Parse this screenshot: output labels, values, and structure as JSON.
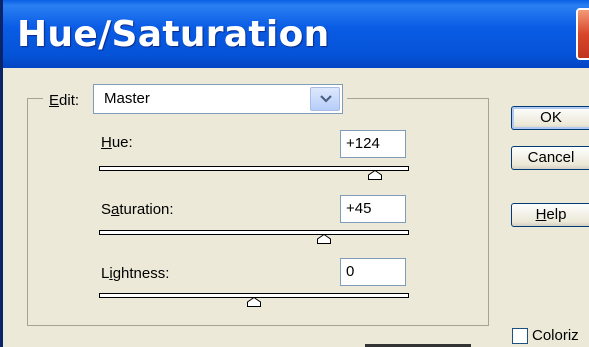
{
  "window": {
    "title": "Hue/Saturation"
  },
  "edit": {
    "label_u": "E",
    "label_rest": "dit:",
    "selected": "Master"
  },
  "sliders": [
    {
      "label_u": "H",
      "label_rest": "ue:",
      "label_pre": "",
      "value": "+124",
      "position": 0.89
    },
    {
      "label_pre": "S",
      "label_u": "a",
      "label_rest": "turation:",
      "value": "+45",
      "position": 0.725
    },
    {
      "label_pre": "L",
      "label_u": "i",
      "label_rest": "ghtness:",
      "value": "0",
      "position": 0.5
    }
  ],
  "buttons": {
    "ok": "OK",
    "cancel": "Cancel",
    "help_u": "H",
    "help_rest": "elp"
  },
  "colorize": {
    "label": "Coloriz",
    "checked": false
  }
}
